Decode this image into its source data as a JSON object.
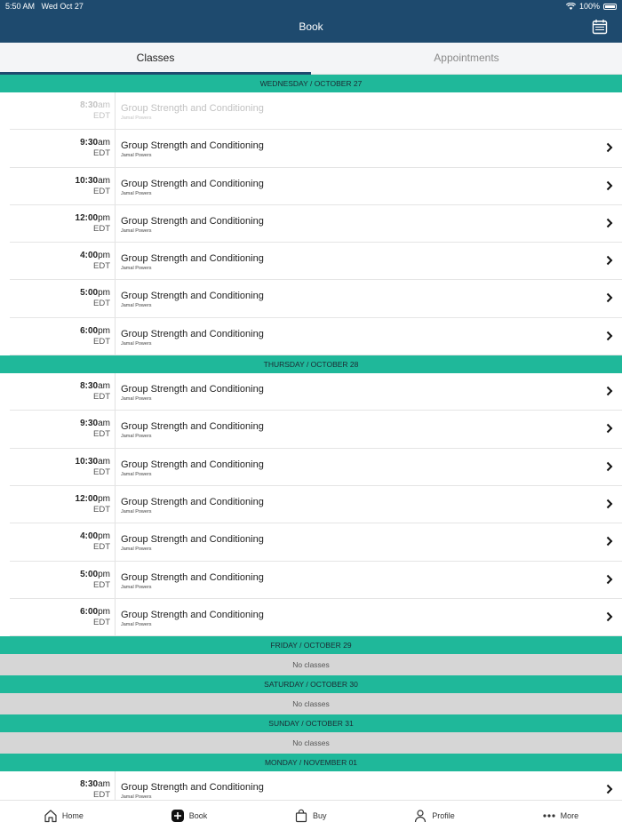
{
  "status": {
    "time": "5:50 AM",
    "date": "Wed Oct 27",
    "battery": "100%"
  },
  "header": {
    "title": "Book"
  },
  "tabs": [
    {
      "label": "Classes",
      "active": true
    },
    {
      "label": "Appointments",
      "active": false
    }
  ],
  "days": [
    {
      "label": "WEDNESDAY / OCTOBER 27",
      "classes": [
        {
          "time": "8:30",
          "ampm": "am",
          "tz": "EDT",
          "name": "Group Strength and Conditioning",
          "instructor": "Jamal Powers",
          "past": true
        },
        {
          "time": "9:30",
          "ampm": "am",
          "tz": "EDT",
          "name": "Group Strength and Conditioning",
          "instructor": "Jamal Powers",
          "past": false
        },
        {
          "time": "10:30",
          "ampm": "am",
          "tz": "EDT",
          "name": "Group Strength and Conditioning",
          "instructor": "Jamal Powers",
          "past": false
        },
        {
          "time": "12:00",
          "ampm": "pm",
          "tz": "EDT",
          "name": "Group Strength and Conditioning",
          "instructor": "Jamal Powers",
          "past": false
        },
        {
          "time": "4:00",
          "ampm": "pm",
          "tz": "EDT",
          "name": "Group Strength and Conditioning",
          "instructor": "Jamal Powers",
          "past": false
        },
        {
          "time": "5:00",
          "ampm": "pm",
          "tz": "EDT",
          "name": "Group Strength and Conditioning",
          "instructor": "Jamal Powers",
          "past": false
        },
        {
          "time": "6:00",
          "ampm": "pm",
          "tz": "EDT",
          "name": "Group Strength and Conditioning",
          "instructor": "Jamal Powers",
          "past": false
        }
      ]
    },
    {
      "label": "THURSDAY / OCTOBER 28",
      "classes": [
        {
          "time": "8:30",
          "ampm": "am",
          "tz": "EDT",
          "name": "Group Strength and Conditioning",
          "instructor": "Jamal Powers",
          "past": false
        },
        {
          "time": "9:30",
          "ampm": "am",
          "tz": "EDT",
          "name": "Group Strength and Conditioning",
          "instructor": "Jamal Powers",
          "past": false
        },
        {
          "time": "10:30",
          "ampm": "am",
          "tz": "EDT",
          "name": "Group Strength and Conditioning",
          "instructor": "Jamal Powers",
          "past": false
        },
        {
          "time": "12:00",
          "ampm": "pm",
          "tz": "EDT",
          "name": "Group Strength and Conditioning",
          "instructor": "Jamal Powers",
          "past": false
        },
        {
          "time": "4:00",
          "ampm": "pm",
          "tz": "EDT",
          "name": "Group Strength and Conditioning",
          "instructor": "Jamal Powers",
          "past": false
        },
        {
          "time": "5:00",
          "ampm": "pm",
          "tz": "EDT",
          "name": "Group Strength and Conditioning",
          "instructor": "Jamal Powers",
          "past": false
        },
        {
          "time": "6:00",
          "ampm": "pm",
          "tz": "EDT",
          "name": "Group Strength and Conditioning",
          "instructor": "Jamal Powers",
          "past": false
        }
      ]
    },
    {
      "label": "FRIDAY / OCTOBER 29",
      "empty": "No classes",
      "classes": []
    },
    {
      "label": "SATURDAY / OCTOBER 30",
      "empty": "No classes",
      "classes": []
    },
    {
      "label": "SUNDAY / OCTOBER 31",
      "empty": "No classes",
      "classes": []
    },
    {
      "label": "MONDAY / NOVEMBER 01",
      "classes": [
        {
          "time": "8:30",
          "ampm": "am",
          "tz": "EDT",
          "name": "Group Strength and Conditioning",
          "instructor": "Jamal Powers",
          "past": false
        }
      ]
    }
  ],
  "nav": [
    {
      "label": "Home",
      "icon": "home-icon"
    },
    {
      "label": "Book",
      "icon": "plus-square-icon"
    },
    {
      "label": "Buy",
      "icon": "shopping-bag-icon"
    },
    {
      "label": "Profile",
      "icon": "person-icon"
    },
    {
      "label": "More",
      "icon": "more-dots-icon"
    }
  ],
  "colors": {
    "header": "#1e4a6e",
    "accent": "#1fb89a",
    "no_classes_bg": "#d6d6d6"
  }
}
